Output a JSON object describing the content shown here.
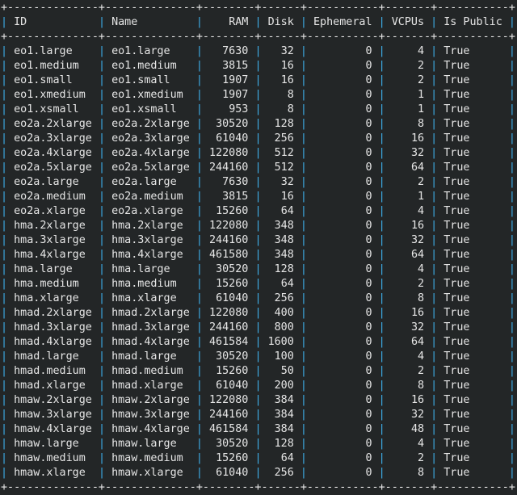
{
  "colors": {
    "background": "#232627",
    "text": "#e6e6e6",
    "pipe": "#3daee9"
  },
  "table": {
    "columns": [
      {
        "label": "ID",
        "align": "left"
      },
      {
        "label": "Name",
        "align": "left"
      },
      {
        "label": "RAM",
        "align": "right"
      },
      {
        "label": "Disk",
        "align": "right"
      },
      {
        "label": "Ephemeral",
        "align": "right"
      },
      {
        "label": "VCPUs",
        "align": "right"
      },
      {
        "label": "Is Public",
        "align": "left"
      }
    ],
    "rows": [
      [
        "eo1.large",
        "eo1.large",
        "7630",
        "32",
        "0",
        "4",
        "True"
      ],
      [
        "eo1.medium",
        "eo1.medium",
        "3815",
        "16",
        "0",
        "2",
        "True"
      ],
      [
        "eo1.small",
        "eo1.small",
        "1907",
        "16",
        "0",
        "2",
        "True"
      ],
      [
        "eo1.xmedium",
        "eo1.xmedium",
        "1907",
        "8",
        "0",
        "1",
        "True"
      ],
      [
        "eo1.xsmall",
        "eo1.xsmall",
        "953",
        "8",
        "0",
        "1",
        "True"
      ],
      [
        "eo2a.2xlarge",
        "eo2a.2xlarge",
        "30520",
        "128",
        "0",
        "8",
        "True"
      ],
      [
        "eo2a.3xlarge",
        "eo2a.3xlarge",
        "61040",
        "256",
        "0",
        "16",
        "True"
      ],
      [
        "eo2a.4xlarge",
        "eo2a.4xlarge",
        "122080",
        "512",
        "0",
        "32",
        "True"
      ],
      [
        "eo2a.5xlarge",
        "eo2a.5xlarge",
        "244160",
        "512",
        "0",
        "64",
        "True"
      ],
      [
        "eo2a.large",
        "eo2a.large",
        "7630",
        "32",
        "0",
        "2",
        "True"
      ],
      [
        "eo2a.medium",
        "eo2a.medium",
        "3815",
        "16",
        "0",
        "1",
        "True"
      ],
      [
        "eo2a.xlarge",
        "eo2a.xlarge",
        "15260",
        "64",
        "0",
        "4",
        "True"
      ],
      [
        "hma.2xlarge",
        "hma.2xlarge",
        "122080",
        "348",
        "0",
        "16",
        "True"
      ],
      [
        "hma.3xlarge",
        "hma.3xlarge",
        "244160",
        "348",
        "0",
        "32",
        "True"
      ],
      [
        "hma.4xlarge",
        "hma.4xlarge",
        "461580",
        "348",
        "0",
        "64",
        "True"
      ],
      [
        "hma.large",
        "hma.large",
        "30520",
        "128",
        "0",
        "4",
        "True"
      ],
      [
        "hma.medium",
        "hma.medium",
        "15260",
        "64",
        "0",
        "2",
        "True"
      ],
      [
        "hma.xlarge",
        "hma.xlarge",
        "61040",
        "256",
        "0",
        "8",
        "True"
      ],
      [
        "hmad.2xlarge",
        "hmad.2xlarge",
        "122080",
        "400",
        "0",
        "16",
        "True"
      ],
      [
        "hmad.3xlarge",
        "hmad.3xlarge",
        "244160",
        "800",
        "0",
        "32",
        "True"
      ],
      [
        "hmad.4xlarge",
        "hmad.4xlarge",
        "461584",
        "1600",
        "0",
        "64",
        "True"
      ],
      [
        "hmad.large",
        "hmad.large",
        "30520",
        "100",
        "0",
        "4",
        "True"
      ],
      [
        "hmad.medium",
        "hmad.medium",
        "15260",
        "50",
        "0",
        "2",
        "True"
      ],
      [
        "hmad.xlarge",
        "hmad.xlarge",
        "61040",
        "200",
        "0",
        "8",
        "True"
      ],
      [
        "hmaw.2xlarge",
        "hmaw.2xlarge",
        "122080",
        "384",
        "0",
        "16",
        "True"
      ],
      [
        "hmaw.3xlarge",
        "hmaw.3xlarge",
        "244160",
        "384",
        "0",
        "32",
        "True"
      ],
      [
        "hmaw.4xlarge",
        "hmaw.4xlarge",
        "461584",
        "384",
        "0",
        "48",
        "True"
      ],
      [
        "hmaw.large",
        "hmaw.large",
        "30520",
        "128",
        "0",
        "4",
        "True"
      ],
      [
        "hmaw.medium",
        "hmaw.medium",
        "15260",
        "64",
        "0",
        "2",
        "True"
      ],
      [
        "hmaw.xlarge",
        "hmaw.xlarge",
        "61040",
        "256",
        "0",
        "8",
        "True"
      ]
    ]
  }
}
